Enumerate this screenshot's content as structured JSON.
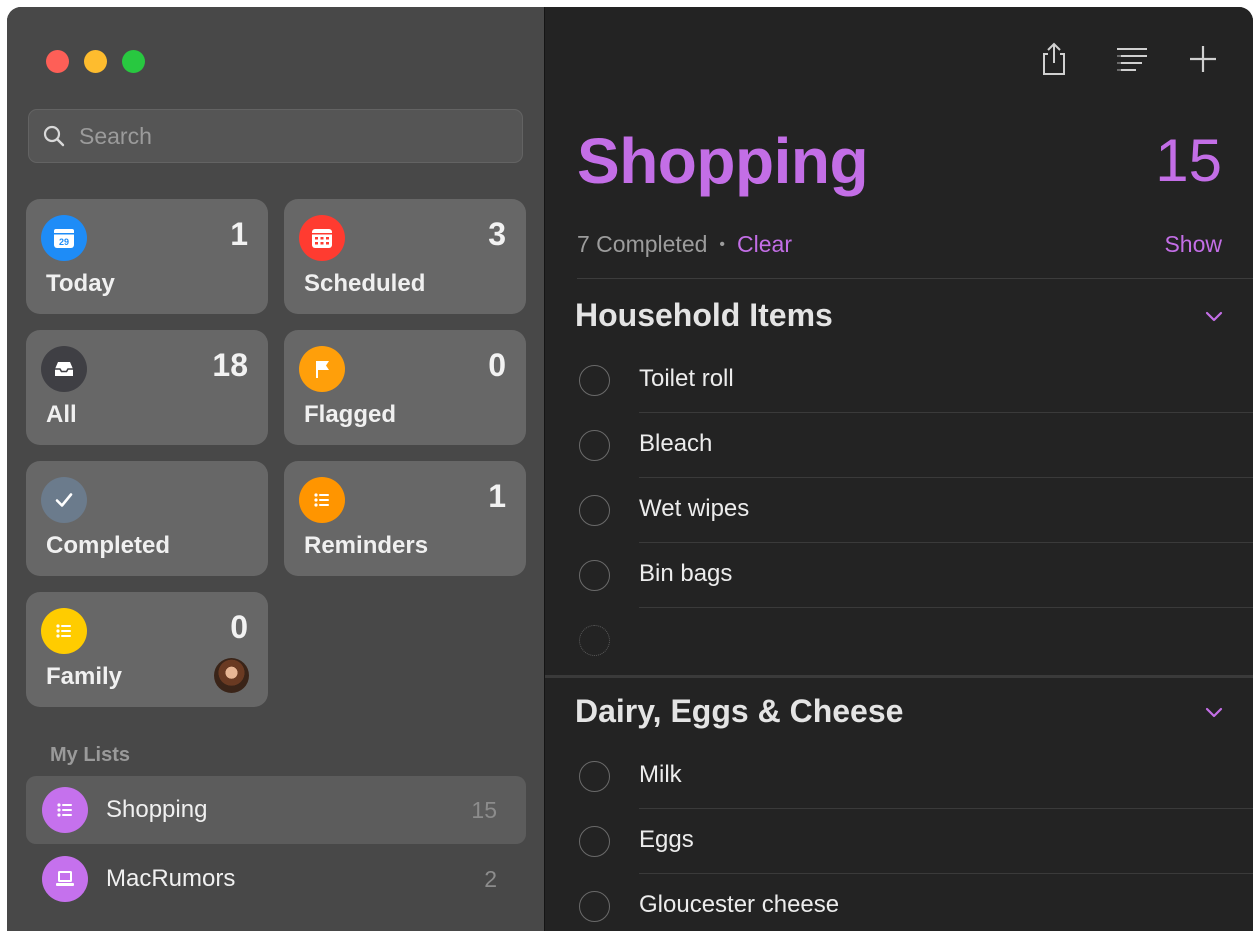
{
  "sidebar": {
    "search": {
      "placeholder": "Search"
    },
    "smart_lists": [
      {
        "label": "Today",
        "count": "1",
        "icon": "calendar-icon",
        "icon_text": "29",
        "color": "#1e8cf7"
      },
      {
        "label": "Scheduled",
        "count": "3",
        "icon": "calendar-grid-icon",
        "color": "#ff3b30"
      },
      {
        "label": "All",
        "count": "18",
        "icon": "tray-icon",
        "color": "#3f3f44"
      },
      {
        "label": "Flagged",
        "count": "0",
        "icon": "flag-icon",
        "color": "#ff9f0a"
      },
      {
        "label": "Completed",
        "count": "",
        "icon": "checkmark-icon",
        "color": "#6b7b8c"
      },
      {
        "label": "Reminders",
        "count": "1",
        "icon": "list-icon",
        "color": "#ff9500"
      },
      {
        "label": "Family",
        "count": "0",
        "icon": "list-icon",
        "color": "#ffcc00"
      }
    ],
    "my_lists_label": "My Lists",
    "my_lists": [
      {
        "name": "Shopping",
        "count": "15",
        "icon": "list-icon",
        "selected": true
      },
      {
        "name": "MacRumors",
        "count": "2",
        "icon": "laptop-icon",
        "selected": false
      }
    ]
  },
  "main": {
    "title": "Shopping",
    "total": "15",
    "completed_text": "7 Completed",
    "separator": "•",
    "clear_label": "Clear",
    "show_label": "Show",
    "accent_color": "#c36ee6",
    "groups": [
      {
        "name": "Household Items",
        "items": [
          "Toilet roll",
          "Bleach",
          "Wet wipes",
          "Bin bags"
        ]
      },
      {
        "name": "Dairy, Eggs & Cheese",
        "items": [
          "Milk",
          "Eggs",
          "Gloucester cheese"
        ]
      }
    ]
  }
}
